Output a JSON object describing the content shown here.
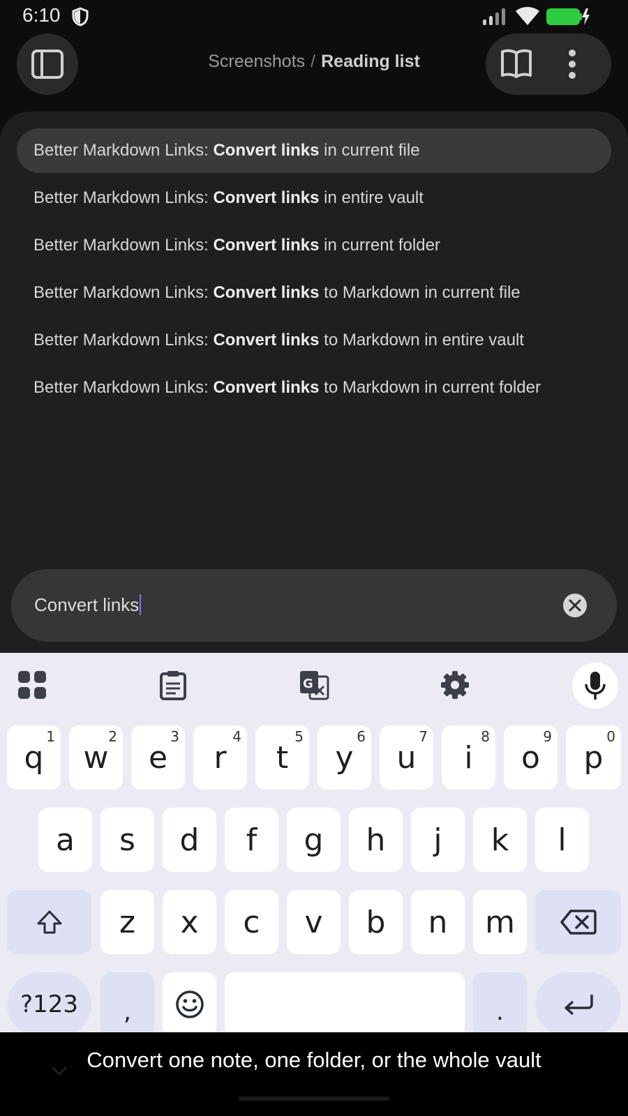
{
  "status_bar": {
    "time": "6:10"
  },
  "header": {
    "breadcrumb_parent": "Screenshots",
    "breadcrumb_separator": "/",
    "breadcrumb_current": "Reading list"
  },
  "suggestions": [
    {
      "prefix": "Better Markdown Links: ",
      "match": "Convert links",
      "suffix": " in current file",
      "selected": true
    },
    {
      "prefix": "Better Markdown Links: ",
      "match": "Convert links",
      "suffix": " in entire vault"
    },
    {
      "prefix": "Better Markdown Links: ",
      "match": "Convert links",
      "suffix": " in current folder"
    },
    {
      "prefix": "Better Markdown Links: ",
      "match": "Convert links",
      "suffix": " to Markdown in current file"
    },
    {
      "prefix": "Better Markdown Links: ",
      "match": "Convert links",
      "suffix": " to Markdown in entire vault"
    },
    {
      "prefix": "Better Markdown Links: ",
      "match": "Convert links",
      "suffix": " to Markdown in current folder"
    }
  ],
  "search": {
    "value": "Convert links"
  },
  "keyboard": {
    "row1": [
      {
        "k": "q",
        "h": "1"
      },
      {
        "k": "w",
        "h": "2"
      },
      {
        "k": "e",
        "h": "3"
      },
      {
        "k": "r",
        "h": "4"
      },
      {
        "k": "t",
        "h": "5"
      },
      {
        "k": "y",
        "h": "6"
      },
      {
        "k": "u",
        "h": "7"
      },
      {
        "k": "i",
        "h": "8"
      },
      {
        "k": "o",
        "h": "9"
      },
      {
        "k": "p",
        "h": "0"
      }
    ],
    "row2": [
      "a",
      "s",
      "d",
      "f",
      "g",
      "h",
      "j",
      "k",
      "l"
    ],
    "row3": [
      "z",
      "x",
      "c",
      "v",
      "b",
      "n",
      "m"
    ],
    "symbols_label": "?123",
    "comma": ",",
    "period": "."
  },
  "caption": {
    "text": "Convert one note, one folder, or the whole vault"
  }
}
